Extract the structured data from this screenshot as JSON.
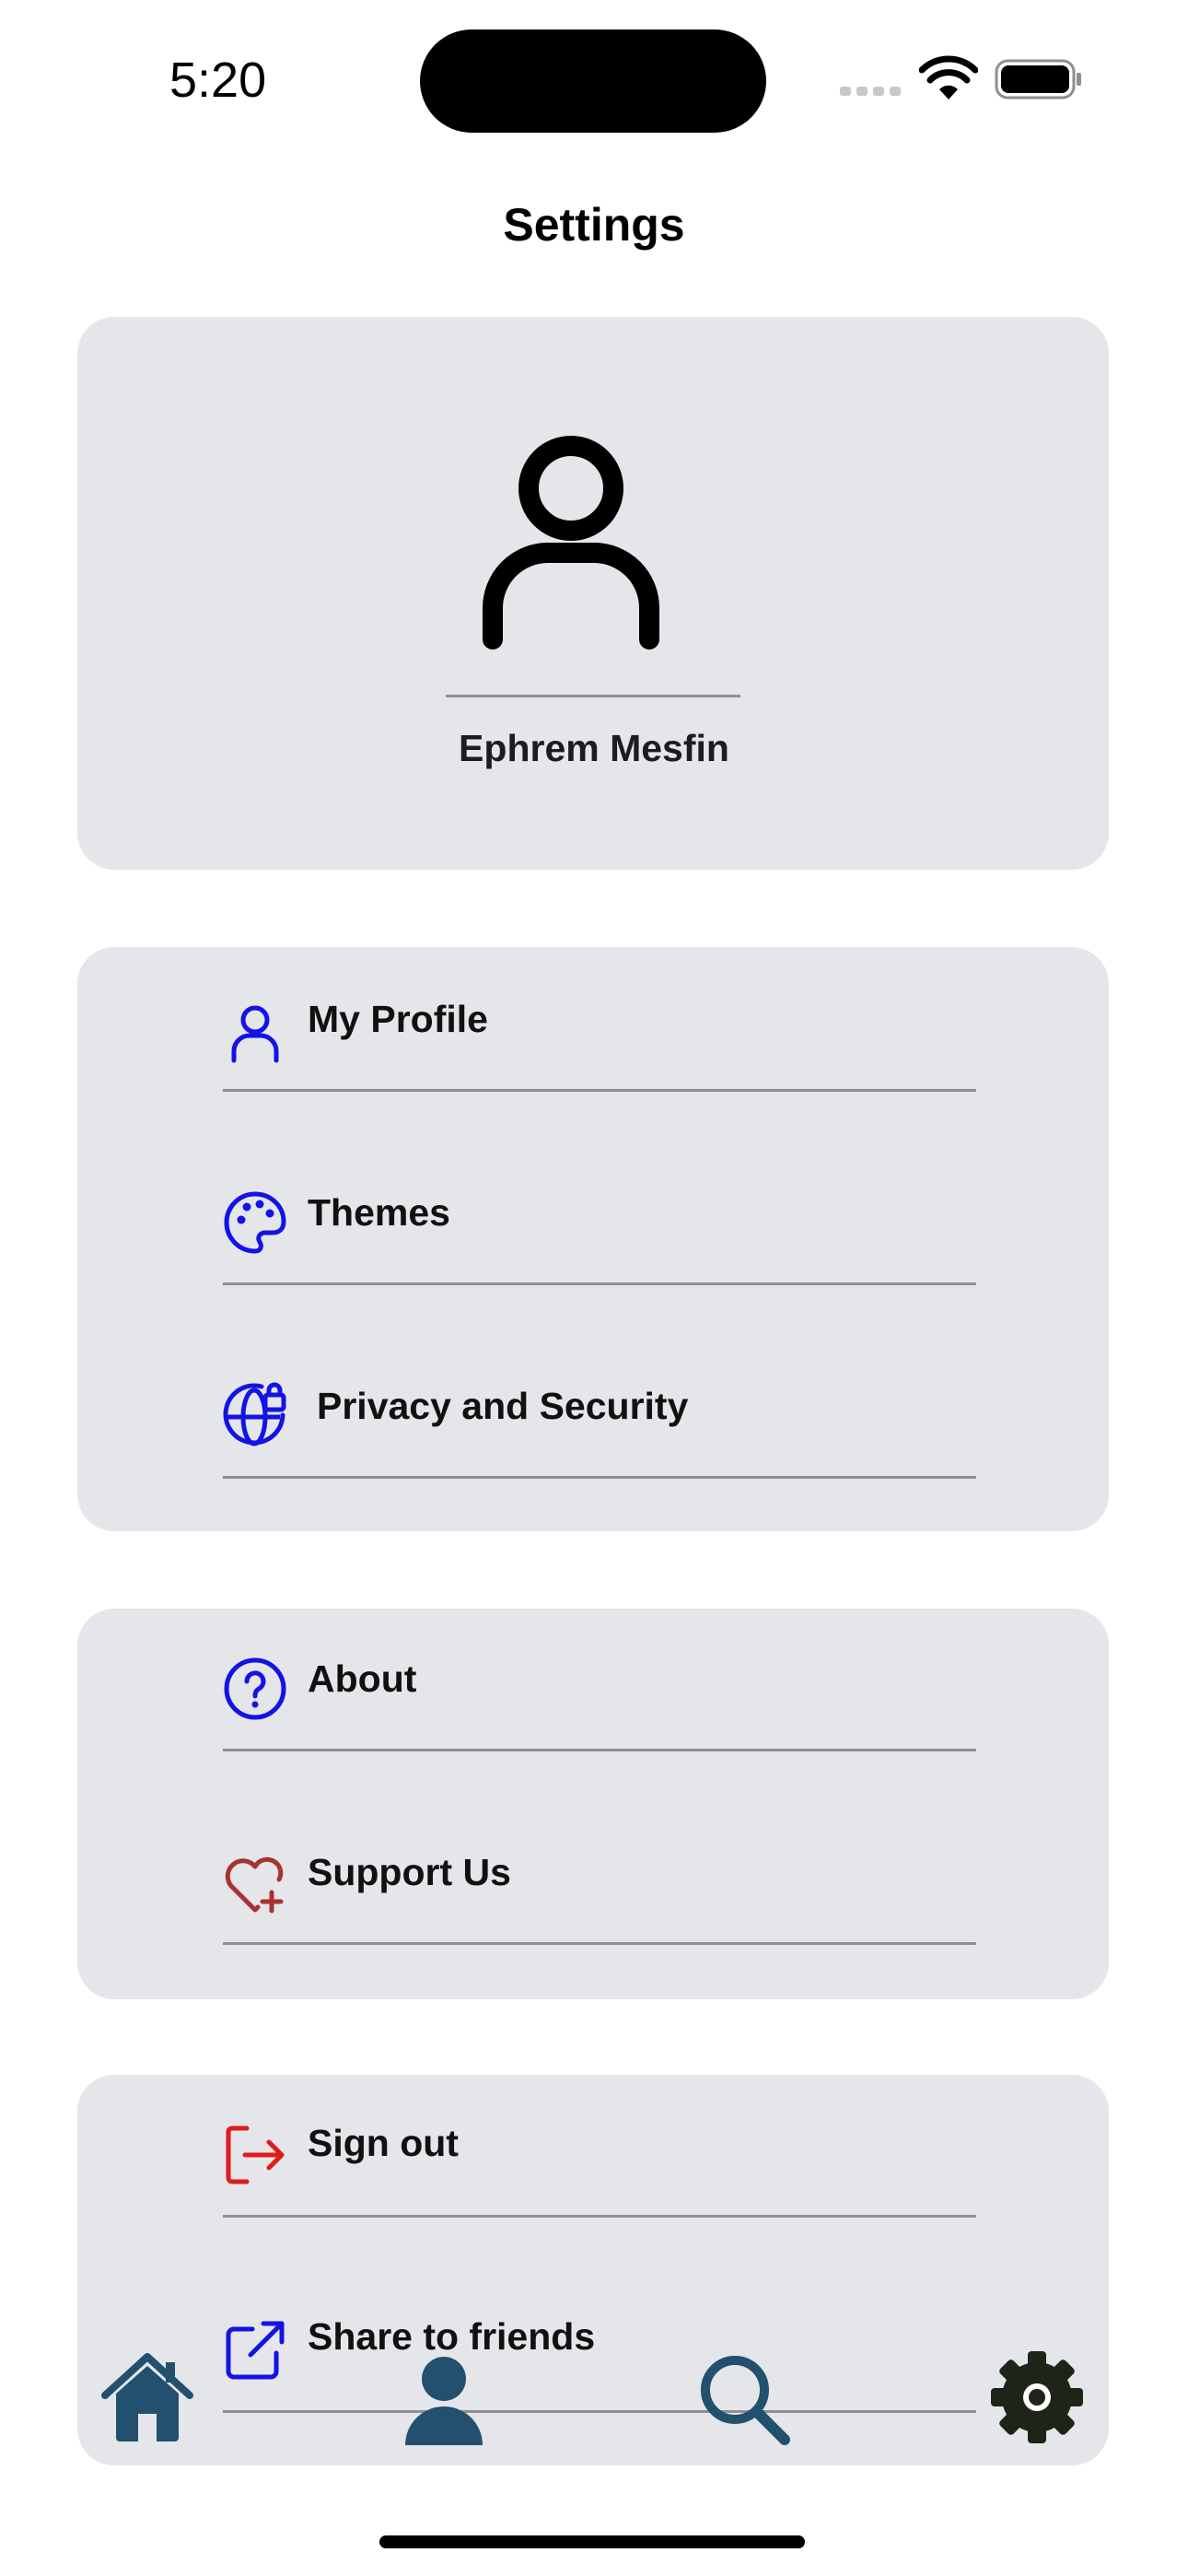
{
  "status_bar": {
    "time": "5:20"
  },
  "header": {
    "title": "Settings"
  },
  "profile": {
    "name": "Ephrem Mesfin",
    "icon": "person-icon"
  },
  "sections": [
    {
      "items": [
        {
          "label": "My Profile",
          "icon": "person-icon",
          "icon_color": "#1313e6"
        },
        {
          "label": "Themes",
          "icon": "palette-icon",
          "icon_color": "#1313e6"
        },
        {
          "label": "Privacy and Security",
          "icon": "globe-lock-icon",
          "icon_color": "#1313e6"
        }
      ]
    },
    {
      "items": [
        {
          "label": "About",
          "icon": "question-circle-icon",
          "icon_color": "#1313e6"
        },
        {
          "label": "Support Us",
          "icon": "heart-plus-icon",
          "icon_color": "#a83232"
        }
      ]
    },
    {
      "items": [
        {
          "label": "Sign out",
          "icon": "sign-out-icon",
          "icon_color": "#e01b1b"
        },
        {
          "label": "Share to friends",
          "icon": "share-external-icon",
          "icon_color": "#1313e6"
        }
      ]
    }
  ],
  "tab_bar": {
    "tabs": [
      {
        "icon": "home-icon",
        "color": "#22506e"
      },
      {
        "icon": "person-icon",
        "color": "#22506e"
      },
      {
        "icon": "search-icon",
        "color": "#22506e"
      },
      {
        "icon": "gear-icon",
        "color": "#1f2419"
      }
    ]
  },
  "colors": {
    "card_background": "#e5e6ea",
    "accent": "#1313e6",
    "divider": "#8e8e93"
  }
}
